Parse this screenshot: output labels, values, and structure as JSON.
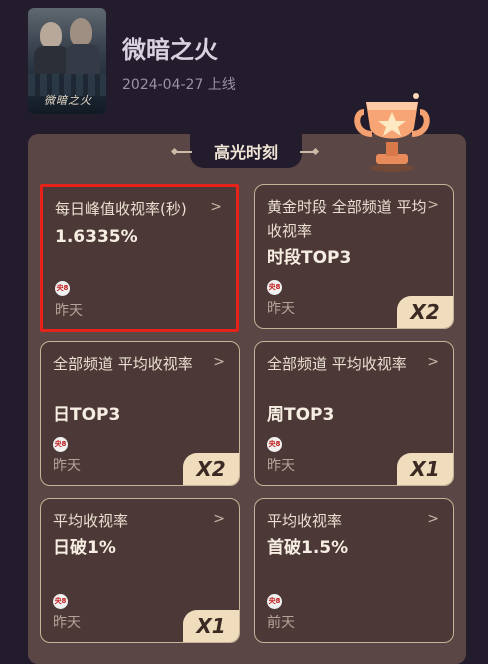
{
  "show": {
    "title": "微暗之火",
    "date_line": "2024-04-27 上线",
    "poster_caption": "微暗之火"
  },
  "highlights": {
    "section_title": "高光时刻",
    "cards": [
      {
        "label": "每日峰值收视率(秒)",
        "value": "1.6335%",
        "channel_logo": "央8",
        "time": "昨天",
        "multiplier": ""
      },
      {
        "label": "黄金时段 全部频道 平均收视率",
        "value": "时段TOP3",
        "channel_logo": "央8",
        "time": "昨天",
        "multiplier": "X2"
      },
      {
        "label": "全部频道 平均收视率",
        "value": "日TOP3",
        "channel_logo": "央8",
        "time": "昨天",
        "multiplier": "X2"
      },
      {
        "label": "全部频道 平均收视率",
        "value": "周TOP3",
        "channel_logo": "央8",
        "time": "昨天",
        "multiplier": "X1"
      },
      {
        "label": "平均收视率",
        "value": "日破1%",
        "channel_logo": "央8",
        "time": "昨天",
        "multiplier": "X1"
      },
      {
        "label": "平均收视率",
        "value": "首破1.5%",
        "channel_logo": "央8",
        "time": "前天",
        "multiplier": ""
      }
    ]
  },
  "icons": {
    "chevron": "chevron-right-icon",
    "trophy": "trophy-icon"
  },
  "colors": {
    "background": "#231c2c",
    "panel": "#5a4644",
    "card": "#4c3836",
    "selection": "#e5231b",
    "badge": "#f0ddbe"
  }
}
